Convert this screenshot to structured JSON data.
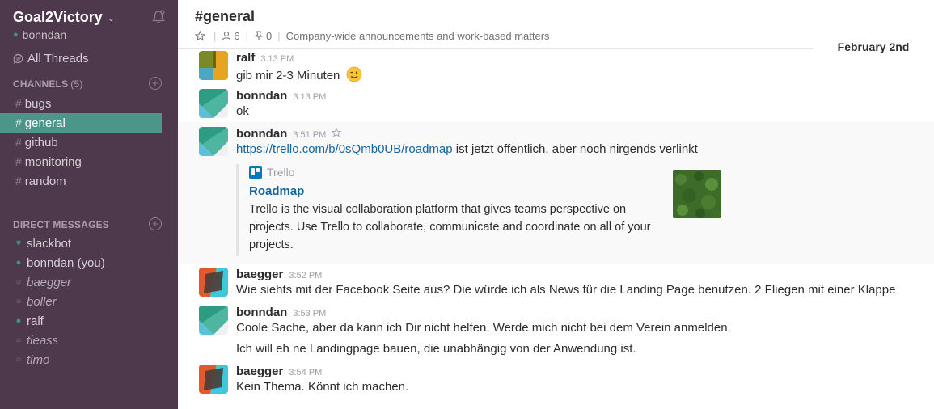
{
  "sidebar": {
    "team_name": "Goal2Victory",
    "current_user": "bonndan",
    "all_threads": "All Threads",
    "channels_heading": "CHANNELS",
    "channels_count": "(5)",
    "channels": [
      {
        "name": "bugs",
        "active": false
      },
      {
        "name": "general",
        "active": true
      },
      {
        "name": "github",
        "active": false
      },
      {
        "name": "monitoring",
        "active": false
      },
      {
        "name": "random",
        "active": false
      }
    ],
    "dm_heading": "DIRECT MESSAGES",
    "dms": [
      {
        "name": "slackbot",
        "status": "online",
        "icon": "heart-icon"
      },
      {
        "name": "bonndan (you)",
        "status": "online",
        "icon": "presence-online-icon"
      },
      {
        "name": "baegger",
        "status": "away",
        "icon": "presence-away-icon"
      },
      {
        "name": "boller",
        "status": "away",
        "icon": "presence-away-icon"
      },
      {
        "name": "ralf",
        "status": "online",
        "icon": "presence-online-icon"
      },
      {
        "name": "tieass",
        "status": "away",
        "icon": "presence-away-icon"
      },
      {
        "name": "timo",
        "status": "away",
        "icon": "presence-away-icon"
      }
    ]
  },
  "header": {
    "channel_name": "#general",
    "member_count": "6",
    "pinned_count": "0",
    "purpose": "Company-wide announcements and work-based matters"
  },
  "date_divider": "February 2nd",
  "messages": [
    {
      "user": "ralf",
      "time": "3:13 PM",
      "text": "gib mir 2-3 Minuten",
      "emoji": "wink"
    },
    {
      "user": "bonndan",
      "time": "3:13 PM",
      "text": "ok"
    },
    {
      "user": "bonndan",
      "time": "3:51 PM",
      "link": "https://trello.com/b/0sQmb0UB/roadmap",
      "text": " ist jetzt öffentlich, aber noch nirgends verlinkt",
      "attachment": {
        "service": "Trello",
        "title": "Roadmap",
        "description": "Trello is the visual collaboration platform that gives teams perspective on projects. Use Trello to collaborate, communicate and coordinate on all of your projects."
      }
    },
    {
      "user": "baegger",
      "time": "3:52 PM",
      "text": "Wie siehts mit der Facebook Seite aus? Die würde ich als News für die Landing Page benutzen. 2 Fliegen mit einer Klappe"
    },
    {
      "user": "bonndan",
      "time": "3:53 PM",
      "text": "Coole Sache, aber da kann ich Dir nicht helfen. Werde mich nicht bei dem Verein anmelden."
    },
    {
      "text": "Ich will eh ne Landingpage bauen, die unabhängig von der Anwendung ist."
    },
    {
      "user": "baegger",
      "time": "3:54 PM",
      "text": "Kein Thema. Könnt ich machen."
    }
  ],
  "colors": {
    "sidebar_bg": "#4d394b",
    "active_channel": "#4c9689",
    "presence_online": "#38978d",
    "link": "#1264a3"
  }
}
